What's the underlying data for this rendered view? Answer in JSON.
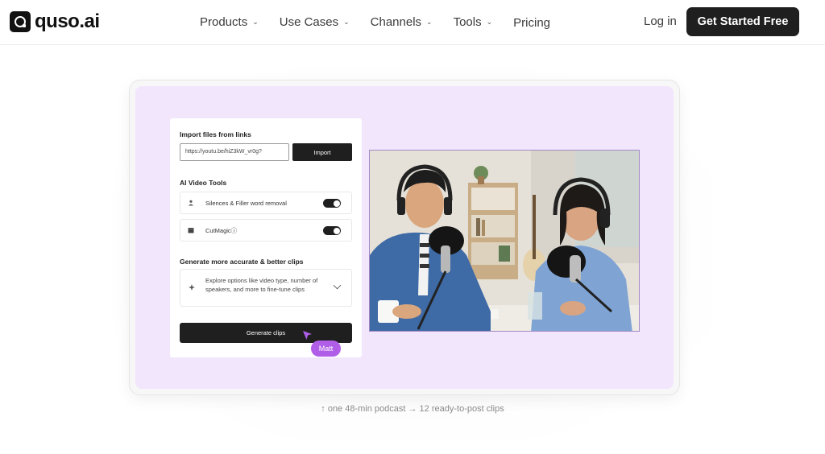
{
  "brand": {
    "name": "quso.ai"
  },
  "nav": {
    "items": [
      {
        "label": "Products",
        "has_dropdown": true
      },
      {
        "label": "Use Cases",
        "has_dropdown": true
      },
      {
        "label": "Channels",
        "has_dropdown": true
      },
      {
        "label": "Tools",
        "has_dropdown": true
      },
      {
        "label": "Pricing",
        "has_dropdown": false
      }
    ],
    "login": "Log in",
    "cta": "Get Started Free"
  },
  "demo": {
    "import_title": "Import files from links",
    "url_value": "https://youtu.be/hiZ3kW_vr0g?",
    "import_button": "Import",
    "tools_title": "AI Video Tools",
    "tools": [
      {
        "label": "Silences & Filler word removal",
        "icon": "person-icon",
        "enabled": true
      },
      {
        "label": "CutMagicⓘ",
        "icon": "clapper-icon",
        "enabled": true
      }
    ],
    "more_title": "Generate more accurate & better clips",
    "options_text": "Explore options like video type, number of speakers, and more to fine-tune clips",
    "generate_button": "Generate clips",
    "cursor_user": "Matt"
  },
  "caption": "↑ one 48-min podcast → 12 ready-to-post clips",
  "colors": {
    "accent_purple": "#b05ee8",
    "stage_bg": "#f2e6fc",
    "dark_button": "#1f1f1f"
  }
}
